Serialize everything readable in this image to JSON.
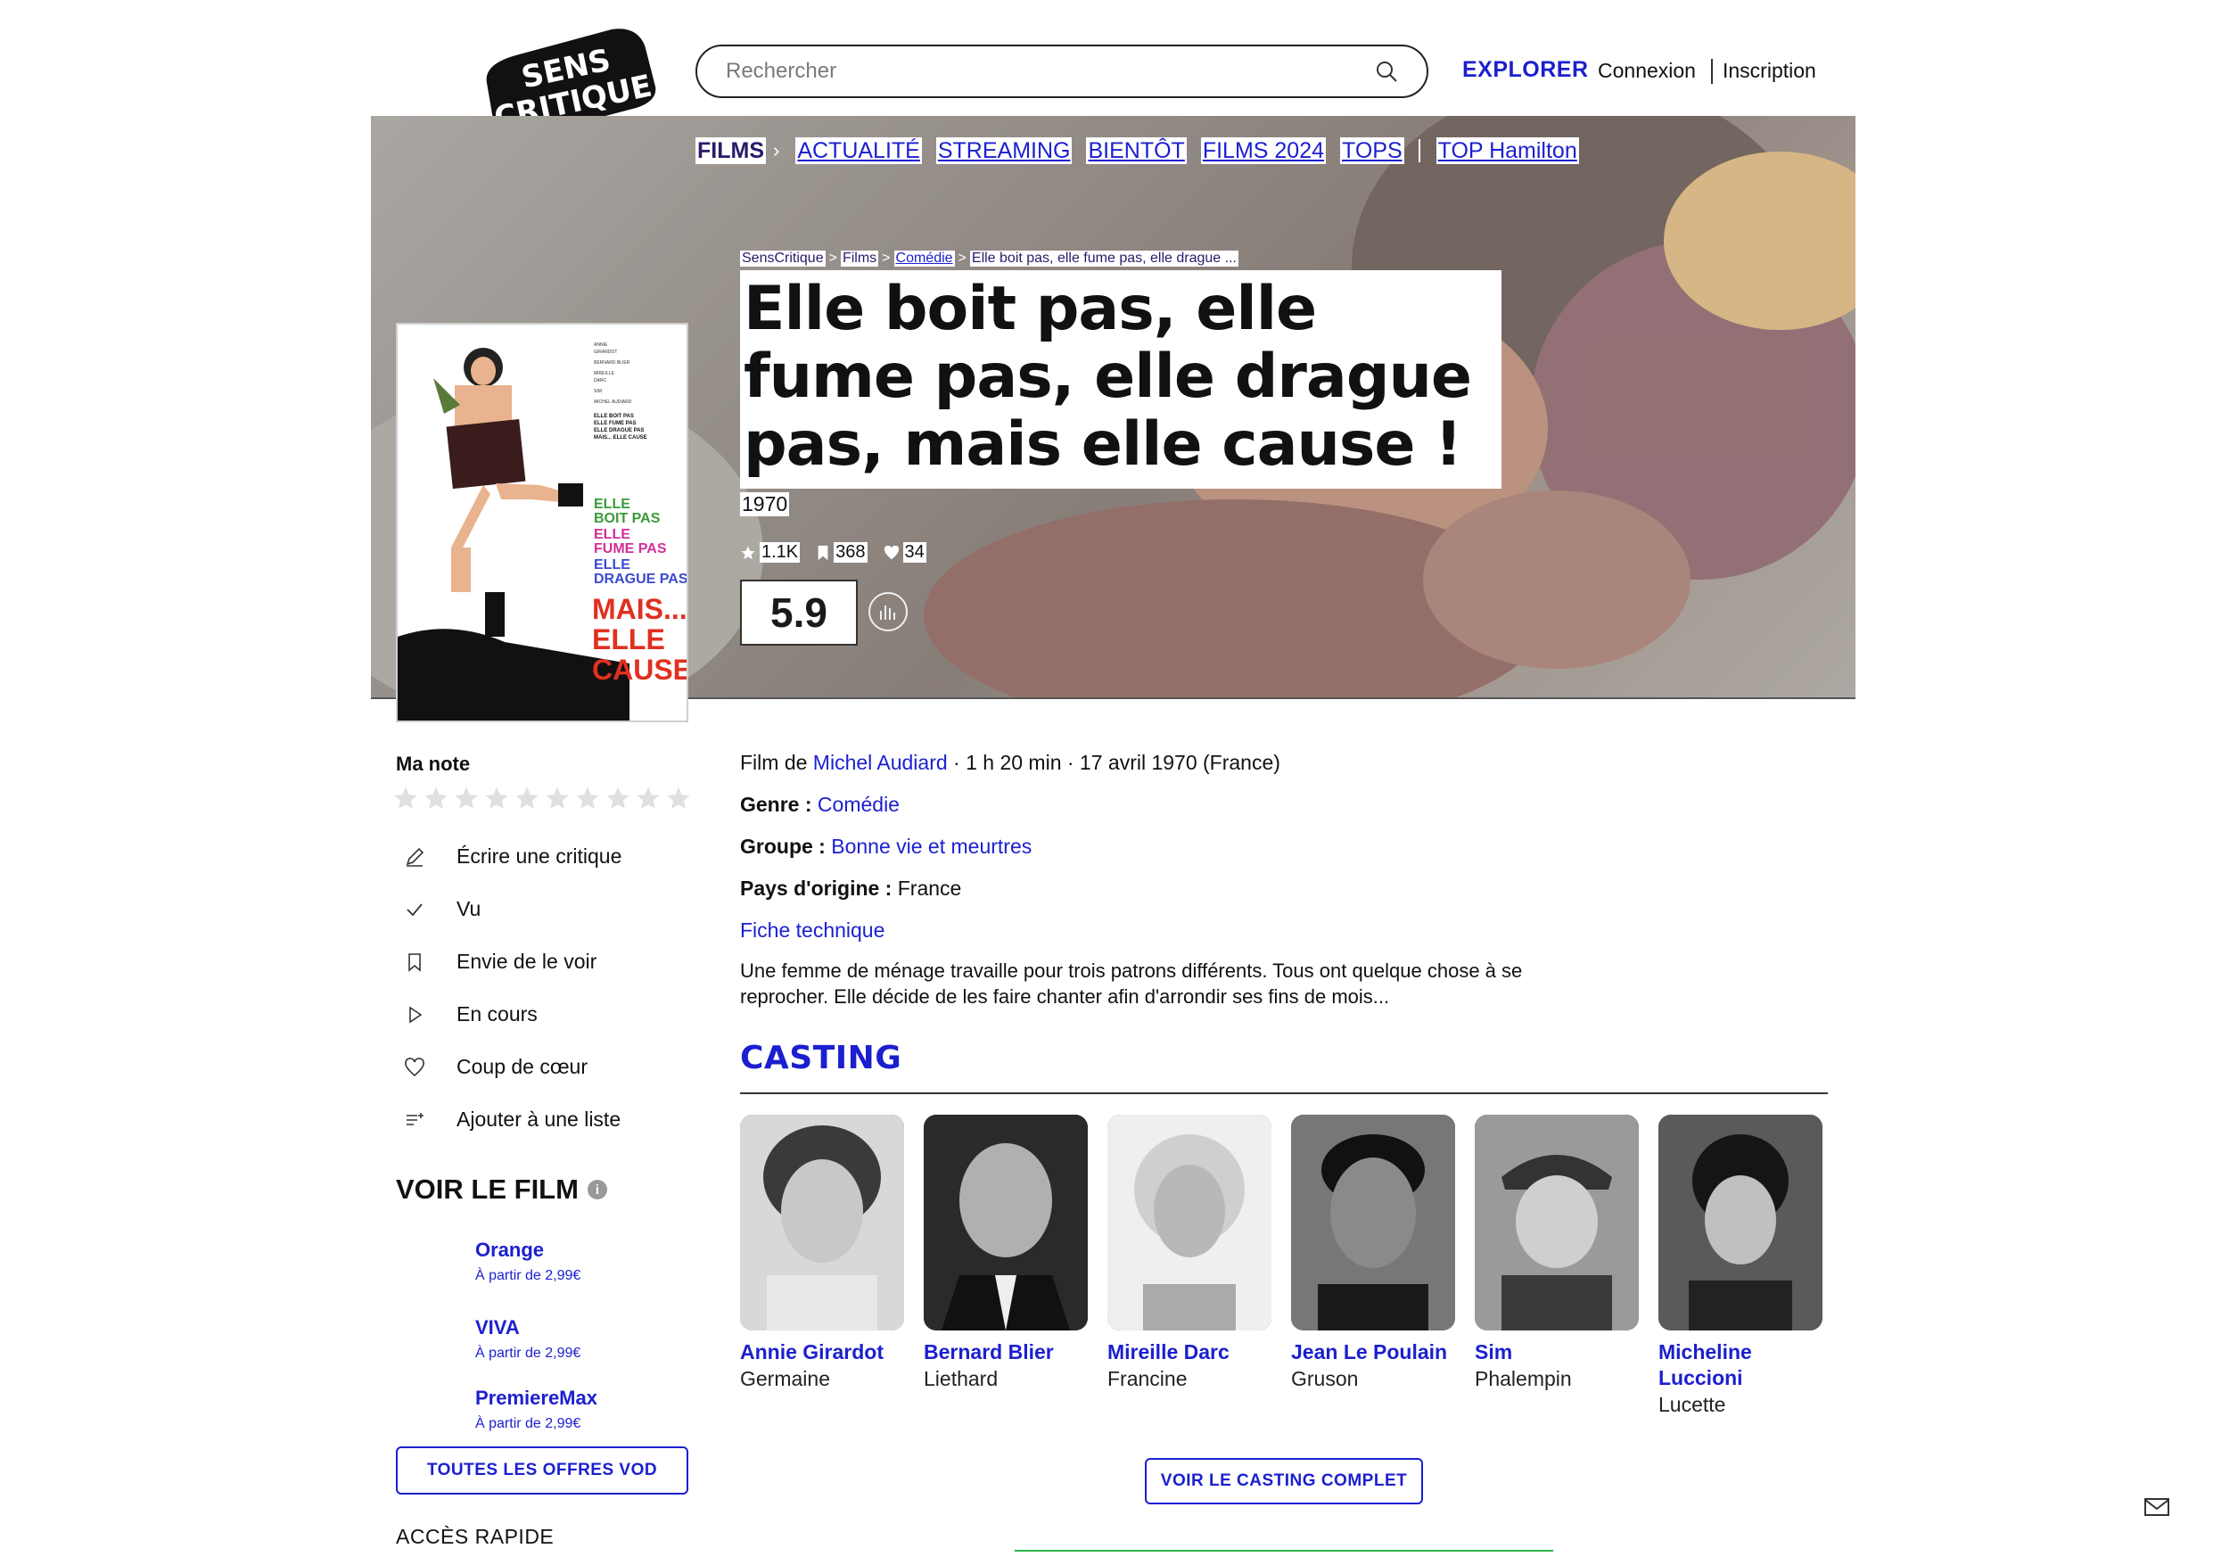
{
  "header": {
    "logo_text": "SENS CRITIQUE",
    "search_placeholder": "Rechercher",
    "explore": "EXPLORER",
    "login": "Connexion",
    "signup": "Inscription"
  },
  "nav": {
    "items": [
      "FILMS",
      "ACTUALITÉ",
      "STREAMING",
      "BIENTÔT",
      "FILMS 2024",
      "TOPS",
      "TOP Hamilton"
    ]
  },
  "breadcrumb": [
    "SensCritique",
    "Films",
    "Comédie",
    "Elle boit pas, elle fume pas, elle drague ..."
  ],
  "film": {
    "title": "Elle boit pas, elle fume pas, elle drague pas, mais elle cause !",
    "year": "1970",
    "stats": {
      "ratings": "1.1K",
      "wishlist": "368",
      "favorites": "34"
    },
    "score": "5.9",
    "poster_text": [
      "ELLE BOIT PAS",
      "ELLE FUME PAS",
      "ELLE DRAGUE PAS",
      "MAIS... ELLE CAUSE"
    ]
  },
  "sidebar": {
    "my_rating_label": "Ma note",
    "actions": [
      "Écrire une critique",
      "Vu",
      "Envie de le voir",
      "En cours",
      "Coup de cœur",
      "Ajouter à une liste"
    ],
    "watch_heading": "VOIR LE FILM",
    "info_icon": "i",
    "vod": [
      {
        "name": "Orange",
        "price": "À partir de 2,99€"
      },
      {
        "name": "VIVA",
        "price": "À partir de 2,99€"
      },
      {
        "name": "PremiereMax",
        "price": "À partir de 2,99€"
      }
    ],
    "all_vod_button": "TOUTES LES OFFRES VOD",
    "quick_access": "ACCÈS RAPIDE"
  },
  "details": {
    "film_by_prefix": "Film de ",
    "director": "Michel Audiard",
    "meta_suffix": " · 1 h 20 min · 17 avril 1970 (France)",
    "genre_label": "Genre : ",
    "genre": "Comédie",
    "group_label": "Groupe : ",
    "group": "Bonne vie et meurtres",
    "country_label": "Pays d'origine : ",
    "country": "France",
    "tech_sheet": "Fiche technique",
    "synopsis": "Une femme de ménage travaille pour trois patrons différents. Tous ont quelque chose à se reprocher. Elle décide de les faire chanter afin d'arrondir ses fins de mois..."
  },
  "casting": {
    "heading": "CASTING",
    "members": [
      {
        "name": "Annie Girardot",
        "role": "Germaine"
      },
      {
        "name": "Bernard Blier",
        "role": "Liethard"
      },
      {
        "name": "Mireille Darc",
        "role": "Francine"
      },
      {
        "name": "Jean Le Poulain",
        "role": "Gruson"
      },
      {
        "name": "Sim",
        "role": "Phalempin"
      },
      {
        "name": "Micheline Luccioni",
        "role": "Lucette"
      }
    ],
    "full_button": "VOIR LE CASTING COMPLET"
  },
  "colors": {
    "accent": "#1b1fcf",
    "nav_active": "#2a1a6a",
    "green_rule": "#2bb34a"
  }
}
